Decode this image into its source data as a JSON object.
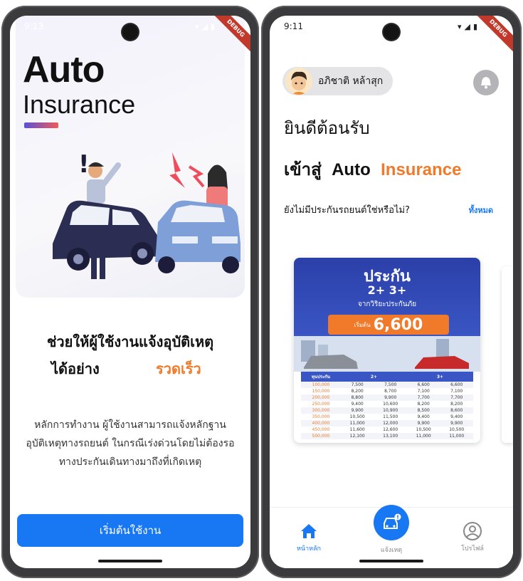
{
  "left_screen": {
    "status_time": "9:13",
    "debug_label": "DEBUG",
    "brand_title": "Auto",
    "brand_subtitle": "Insurance",
    "headline_line1": "ช่วยให้ผู้ใช้งานแจ้งอุบัติเหตุ",
    "headline_line2": "ได้อย่าง",
    "headline_accent": "รวดเร็ว",
    "description": "หลักการทำงาน ผู้ใช้งานสามารถแจ้งหลักฐานอุบัติเหตุทางรถยนต์ ในกรณีเร่งด่วนโดยไม่ต้องรอทางประกันเดินทางมาถึงที่เกิดเหตุ",
    "start_button": "เริ่มต้นใช้งาน"
  },
  "right_screen": {
    "status_time": "9:11",
    "debug_label": "DEBUG",
    "user_name": "อภิชาติ หล้าสุก",
    "welcome": "ยินดีต้อนรับ",
    "enter_prefix": "เข้าสู่",
    "enter_auto": "Auto",
    "enter_accent": "Insurance",
    "question": "ยังไม่มีประกันรถยนต์ใช่หรือไม่?",
    "see_all": "ทั้งหมด",
    "promo": {
      "title": "ประกัน",
      "plans": "2+ 3+",
      "subtitle": "จากวิริยะประกันภัย",
      "price_prefix": "เริ่มต้น",
      "price": "6,600",
      "table_headers": [
        "ทุนประกัน",
        "2+",
        "",
        "3+",
        ""
      ],
      "rows": [
        [
          "100,000",
          "7,500",
          "7,500",
          "6,600",
          "6,600"
        ],
        [
          "150,000",
          "8,200",
          "8,700",
          "7,100",
          "7,100"
        ],
        [
          "200,000",
          "8,800",
          "9,900",
          "7,700",
          "7,700"
        ],
        [
          "250,000",
          "9,400",
          "10,600",
          "8,200",
          "8,200"
        ],
        [
          "300,000",
          "9,900",
          "10,900",
          "8,500",
          "8,600"
        ],
        [
          "350,000",
          "10,500",
          "11,500",
          "9,400",
          "9,400"
        ],
        [
          "400,000",
          "11,000",
          "12,000",
          "9,900",
          "9,900"
        ],
        [
          "450,000",
          "11,600",
          "12,600",
          "10,500",
          "10,500"
        ],
        [
          "500,000",
          "12,100",
          "13,100",
          "11,000",
          "11,000"
        ]
      ]
    },
    "nav": {
      "home": "หน้าหลัก",
      "report": "แจ้งเหตุ",
      "profile": "โปรไฟล์"
    }
  },
  "colors": {
    "primary": "#1877f2",
    "accent": "#f07a2a",
    "promo_blue": "#2b3fa8"
  }
}
